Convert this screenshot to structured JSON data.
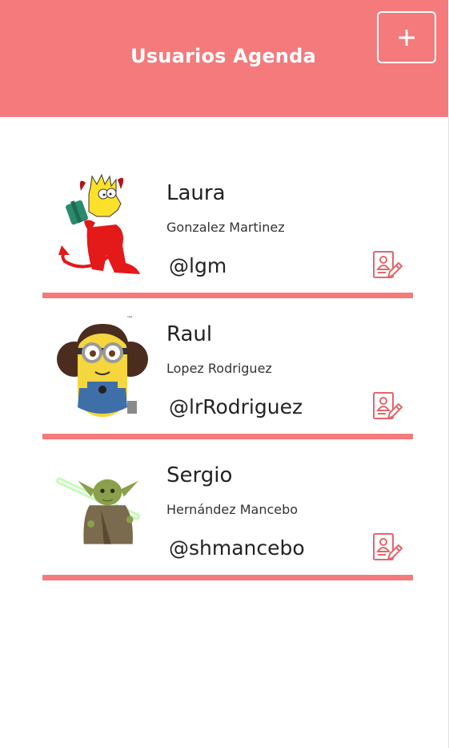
{
  "header": {
    "title": "Usuarios Agenda",
    "add_button_icon": "plus-icon"
  },
  "colors": {
    "accent": "#f47a7c",
    "background": "#ffffff",
    "text": "#222222"
  },
  "users": [
    {
      "name": "Laura",
      "surname": "Gonzalez Martinez",
      "handle": "@lgm",
      "avatar": "devil-bart-avatar",
      "edit_icon": "edit-contact-icon"
    },
    {
      "name": "Raul",
      "surname": "Lopez Rodriguez",
      "handle": "@lrRodriguez",
      "avatar": "minion-avatar",
      "edit_icon": "edit-contact-icon"
    },
    {
      "name": "Sergio",
      "surname": "Hernández Mancebo",
      "handle": "@shmancebo",
      "avatar": "yoda-avatar",
      "edit_icon": "edit-contact-icon"
    }
  ]
}
